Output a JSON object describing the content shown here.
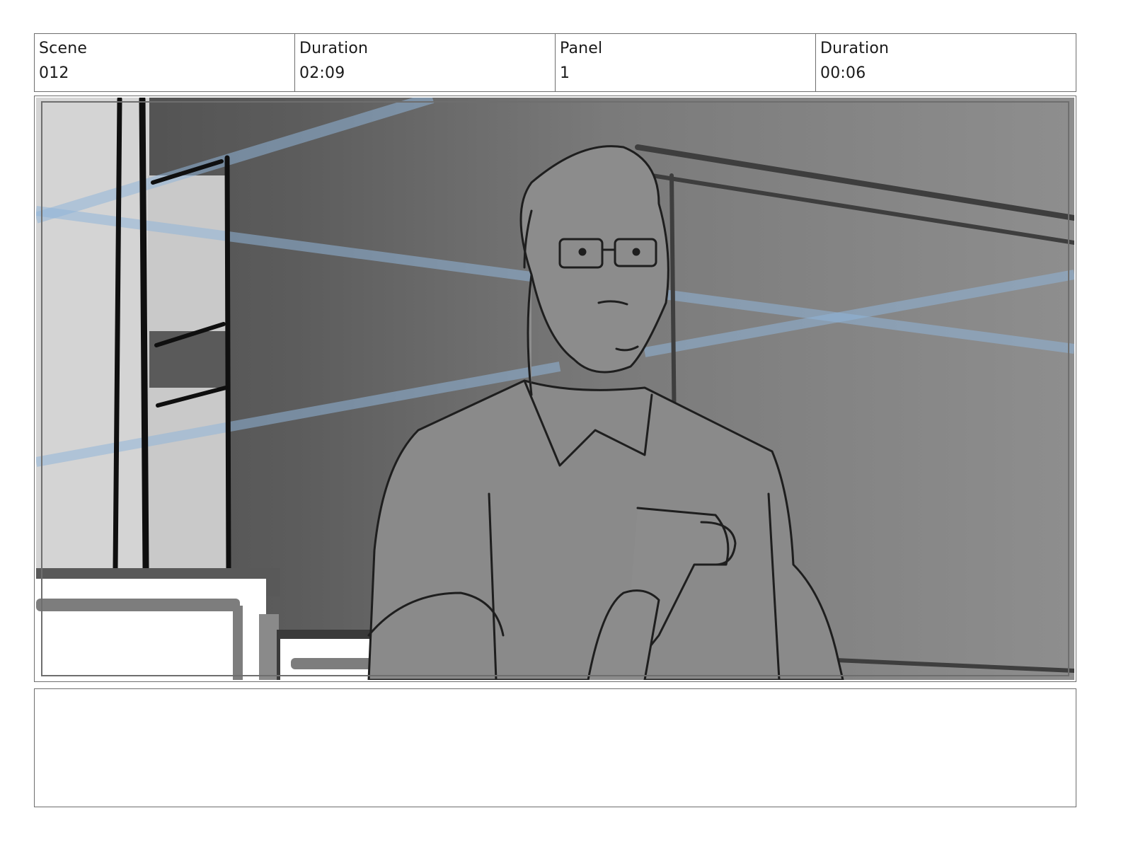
{
  "header": {
    "cells": [
      {
        "label": "Scene",
        "value": "012"
      },
      {
        "label": "Duration",
        "value": "02:09"
      },
      {
        "label": "Panel",
        "value": "1"
      },
      {
        "label": "Duration",
        "value": "00:06"
      }
    ]
  },
  "panel": {
    "image_description_icon": "storyboard-sketch",
    "colors": {
      "background_dark": "#5a5a5a",
      "background_light": "#8c8c8c",
      "light_beam": "#8fb4d8",
      "line_art": "#1e1e1e"
    }
  },
  "notes": {
    "text": ""
  }
}
